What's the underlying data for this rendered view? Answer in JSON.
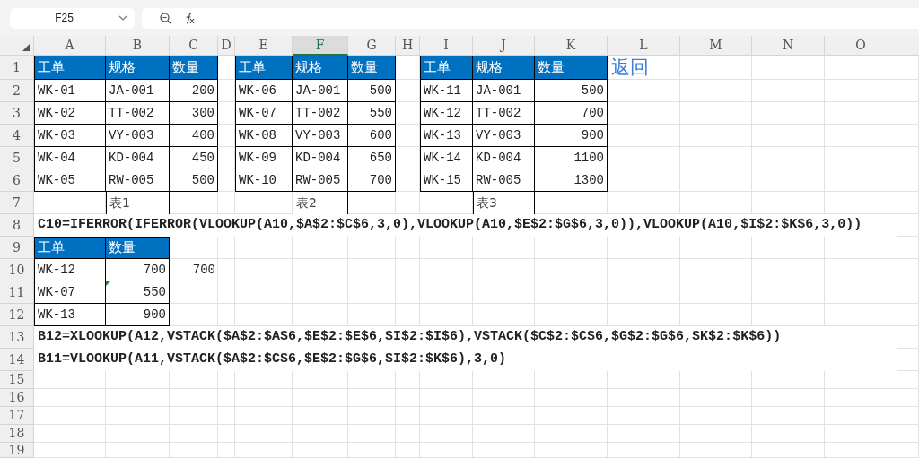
{
  "name_box": {
    "value": "F25"
  },
  "columns": [
    {
      "label": "A",
      "selected": false
    },
    {
      "label": "B",
      "selected": false
    },
    {
      "label": "C",
      "selected": false
    },
    {
      "label": "D",
      "selected": false
    },
    {
      "label": "E",
      "selected": false
    },
    {
      "label": "F",
      "selected": true
    },
    {
      "label": "G",
      "selected": false
    },
    {
      "label": "H",
      "selected": false
    },
    {
      "label": "I",
      "selected": false
    },
    {
      "label": "J",
      "selected": false
    },
    {
      "label": "K",
      "selected": false
    },
    {
      "label": "L",
      "selected": false
    },
    {
      "label": "M",
      "selected": false
    },
    {
      "label": "N",
      "selected": false
    },
    {
      "label": "O",
      "selected": false
    }
  ],
  "rows": [
    {
      "label": "1",
      "selected": false
    },
    {
      "label": "2",
      "selected": false
    },
    {
      "label": "3",
      "selected": false
    },
    {
      "label": "4",
      "selected": false
    },
    {
      "label": "5",
      "selected": false
    },
    {
      "label": "6",
      "selected": false
    },
    {
      "label": "7",
      "selected": false
    },
    {
      "label": "8",
      "selected": false
    },
    {
      "label": "9",
      "selected": false
    },
    {
      "label": "10",
      "selected": false
    },
    {
      "label": "11",
      "selected": false
    },
    {
      "label": "12",
      "selected": false
    },
    {
      "label": "13",
      "selected": false
    },
    {
      "label": "14",
      "selected": false
    },
    {
      "label": "15",
      "selected": false
    },
    {
      "label": "16",
      "selected": false
    },
    {
      "label": "17",
      "selected": false
    },
    {
      "label": "18",
      "selected": false
    },
    {
      "label": "19",
      "selected": false
    }
  ],
  "tables": [
    {
      "headers": [
        "工单",
        "规格",
        "数量"
      ],
      "rows": [
        [
          "WK-01",
          "JA-001",
          "200"
        ],
        [
          "WK-02",
          "TT-002",
          "300"
        ],
        [
          "WK-03",
          "VY-003",
          "400"
        ],
        [
          "WK-04",
          "KD-004",
          "450"
        ],
        [
          "WK-05",
          "RW-005",
          "500"
        ]
      ],
      "caption": "表1"
    },
    {
      "headers": [
        "工单",
        "规格",
        "数量"
      ],
      "rows": [
        [
          "WK-06",
          "JA-001",
          "500"
        ],
        [
          "WK-07",
          "TT-002",
          "550"
        ],
        [
          "WK-08",
          "VY-003",
          "600"
        ],
        [
          "WK-09",
          "KD-004",
          "650"
        ],
        [
          "WK-10",
          "RW-005",
          "700"
        ]
      ],
      "caption": "表2"
    },
    {
      "headers": [
        "工单",
        "规格",
        "数量"
      ],
      "rows": [
        [
          "WK-11",
          "JA-001",
          "500"
        ],
        [
          "WK-12",
          "TT-002",
          "700"
        ],
        [
          "WK-13",
          "VY-003",
          "900"
        ],
        [
          "WK-14",
          "KD-004",
          "1100"
        ],
        [
          "WK-15",
          "RW-005",
          "1300"
        ]
      ],
      "caption": "表3"
    }
  ],
  "link": "返回",
  "formulas": [
    "C10=IFERROR(IFERROR(VLOOKUP(A10,$A$2:$C$6,3,0),VLOOKUP(A10,$E$2:$G$6,3,0)),VLOOKUP(A10,$I$2:$K$6,3,0))",
    "B12=XLOOKUP(A12,VSTACK($A$2:$A$6,$E$2:$E$6,$I$2:$I$6),VSTACK($C$2:$C$6,$G$2:$G$6,$K$2:$K$6))",
    "B11=VLOOKUP(A11,VSTACK($A$2:$C$6,$E$2:$G$6,$I$2:$K$6),3,0)"
  ],
  "lookup": {
    "headers": [
      "工单",
      "数量"
    ],
    "rows": [
      {
        "cells": [
          "WK-12",
          "700"
        ],
        "error_flag": false
      },
      {
        "cells": [
          "WK-07",
          "550"
        ],
        "error_flag": true
      },
      {
        "cells": [
          "WK-13",
          "900"
        ],
        "error_flag": false
      }
    ],
    "result": "700"
  }
}
